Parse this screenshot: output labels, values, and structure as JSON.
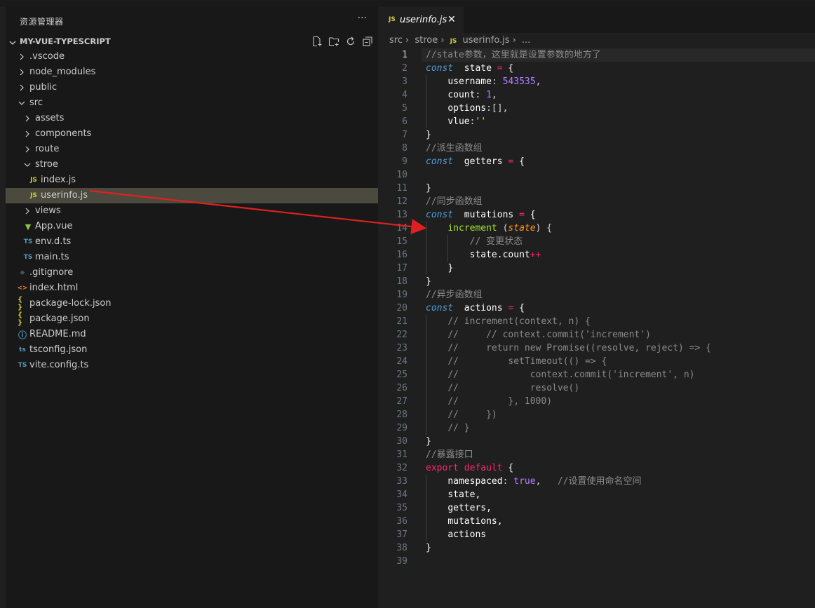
{
  "explorer": {
    "title": "资源管理器",
    "more": "···",
    "project": "MY-VUE-TYPESCRIPT",
    "items": [
      {
        "label": ".vscode",
        "kind": "folder",
        "depth": 0,
        "open": false
      },
      {
        "label": "node_modules",
        "kind": "folder",
        "depth": 0,
        "open": false
      },
      {
        "label": "public",
        "kind": "folder",
        "depth": 0,
        "open": false
      },
      {
        "label": "src",
        "kind": "folder",
        "depth": 0,
        "open": true
      },
      {
        "label": "assets",
        "kind": "folder",
        "depth": 1,
        "open": false
      },
      {
        "label": "components",
        "kind": "folder",
        "depth": 1,
        "open": false
      },
      {
        "label": "route",
        "kind": "folder",
        "depth": 1,
        "open": false
      },
      {
        "label": "stroe",
        "kind": "folder",
        "depth": 1,
        "open": true
      },
      {
        "label": "index.js",
        "kind": "js",
        "depth": 2
      },
      {
        "label": "userinfo.js",
        "kind": "js",
        "depth": 2,
        "selected": true
      },
      {
        "label": "views",
        "kind": "folder",
        "depth": 1,
        "open": false
      },
      {
        "label": "App.vue",
        "kind": "vue",
        "depth": 1
      },
      {
        "label": "env.d.ts",
        "kind": "ts",
        "depth": 1
      },
      {
        "label": "main.ts",
        "kind": "ts",
        "depth": 1
      },
      {
        "label": ".gitignore",
        "kind": "git",
        "depth": 0
      },
      {
        "label": "index.html",
        "kind": "html",
        "depth": 0
      },
      {
        "label": "package-lock.json",
        "kind": "json",
        "depth": 0
      },
      {
        "label": "package.json",
        "kind": "json",
        "depth": 0
      },
      {
        "label": "README.md",
        "kind": "info",
        "depth": 0
      },
      {
        "label": "tsconfig.json",
        "kind": "tsconfig",
        "depth": 0
      },
      {
        "label": "vite.config.ts",
        "kind": "ts",
        "depth": 0
      }
    ]
  },
  "editor": {
    "tab": {
      "icon": "JS",
      "label": "userinfo.js",
      "close": "✕"
    },
    "breadcrumb": [
      "src",
      "stroe",
      "userinfo.js",
      "..."
    ],
    "active_line": 1,
    "lines": [
      [
        [
          "c-cmt",
          "//state参数，这里就是设置参数的地方了"
        ]
      ],
      [
        [
          "c-kw",
          "const"
        ],
        [
          "",
          "  "
        ],
        [
          "c-var",
          "state"
        ],
        [
          "c-op",
          " ="
        ],
        [
          "c-var",
          " {"
        ]
      ],
      [
        [
          "",
          "    "
        ],
        [
          "c-var",
          "username"
        ],
        [
          "",
          ": "
        ],
        [
          "c-num",
          "543535"
        ],
        [
          "",
          ","
        ]
      ],
      [
        [
          "",
          "    "
        ],
        [
          "c-var",
          "count"
        ],
        [
          "",
          ": "
        ],
        [
          "c-num",
          "1"
        ],
        [
          "",
          ","
        ]
      ],
      [
        [
          "",
          "    "
        ],
        [
          "c-var",
          "options"
        ],
        [
          "",
          ":[],"
        ]
      ],
      [
        [
          "",
          "    "
        ],
        [
          "c-var",
          "vlue"
        ],
        [
          "",
          ":"
        ],
        [
          "c-str",
          "''"
        ]
      ],
      [
        [
          "c-var",
          "}"
        ]
      ],
      [
        [
          "c-cmt",
          "//派生函数组"
        ]
      ],
      [
        [
          "c-kw",
          "const"
        ],
        [
          "",
          "  "
        ],
        [
          "c-var",
          "getters"
        ],
        [
          "c-op",
          " ="
        ],
        [
          "c-var",
          " {"
        ]
      ],
      [
        [
          "",
          ""
        ]
      ],
      [
        [
          "c-var",
          "}"
        ]
      ],
      [
        [
          "c-cmt",
          "//同步函数组"
        ]
      ],
      [
        [
          "c-kw",
          "const"
        ],
        [
          "",
          "  "
        ],
        [
          "c-var",
          "mutations"
        ],
        [
          "c-op",
          " ="
        ],
        [
          "c-var",
          " {"
        ]
      ],
      [
        [
          "",
          "    "
        ],
        [
          "c-fn",
          "increment"
        ],
        [
          "",
          " ("
        ],
        [
          "c-param",
          "state"
        ],
        [
          "",
          ") {"
        ]
      ],
      [
        [
          "",
          "        "
        ],
        [
          "c-cmt",
          "// 变更状态"
        ]
      ],
      [
        [
          "",
          "        "
        ],
        [
          "c-var",
          "state.count"
        ],
        [
          "c-red",
          "++"
        ]
      ],
      [
        [
          "",
          "    "
        ],
        [
          "c-var",
          "}"
        ]
      ],
      [
        [
          "c-var",
          "}"
        ]
      ],
      [
        [
          "c-cmt",
          "//异步函数组"
        ]
      ],
      [
        [
          "c-kw",
          "const"
        ],
        [
          "",
          "  "
        ],
        [
          "c-var",
          "actions"
        ],
        [
          "c-op",
          " ="
        ],
        [
          "c-var",
          " {"
        ]
      ],
      [
        [
          "",
          "    "
        ],
        [
          "c-cmt",
          "// increment(context, n) {"
        ]
      ],
      [
        [
          "",
          "    "
        ],
        [
          "c-cmt",
          "//     // context.commit('increment')"
        ]
      ],
      [
        [
          "",
          "    "
        ],
        [
          "c-cmt",
          "//     return new Promise((resolve, reject) => {"
        ]
      ],
      [
        [
          "",
          "    "
        ],
        [
          "c-cmt",
          "//         setTimeout(() => {"
        ]
      ],
      [
        [
          "",
          "    "
        ],
        [
          "c-cmt",
          "//             context.commit('increment', n)"
        ]
      ],
      [
        [
          "",
          "    "
        ],
        [
          "c-cmt",
          "//             resolve()"
        ]
      ],
      [
        [
          "",
          "    "
        ],
        [
          "c-cmt",
          "//         }, 1000)"
        ]
      ],
      [
        [
          "",
          "    "
        ],
        [
          "c-cmt",
          "//     })"
        ]
      ],
      [
        [
          "",
          "    "
        ],
        [
          "c-cmt",
          "// }"
        ]
      ],
      [
        [
          "c-var",
          "}"
        ]
      ],
      [
        [
          "c-cmt",
          "//暴露接口"
        ]
      ],
      [
        [
          "c-red",
          "export"
        ],
        [
          "",
          ""
        ],
        [
          "c-red",
          " default"
        ],
        [
          "c-var",
          " {"
        ]
      ],
      [
        [
          "",
          "    "
        ],
        [
          "c-var",
          "namespaced"
        ],
        [
          "",
          ": "
        ],
        [
          "c-kw2",
          "true"
        ],
        [
          "",
          ",   "
        ],
        [
          "c-cmt",
          "//设置使用命名空间"
        ]
      ],
      [
        [
          "",
          "    "
        ],
        [
          "c-var",
          "state,"
        ]
      ],
      [
        [
          "",
          "    "
        ],
        [
          "c-var",
          "getters,"
        ]
      ],
      [
        [
          "",
          "    "
        ],
        [
          "c-var",
          "mutations,"
        ]
      ],
      [
        [
          "",
          "    "
        ],
        [
          "c-var",
          "actions"
        ]
      ],
      [
        [
          "c-var",
          "}"
        ]
      ],
      [
        [
          "",
          ""
        ]
      ]
    ]
  }
}
